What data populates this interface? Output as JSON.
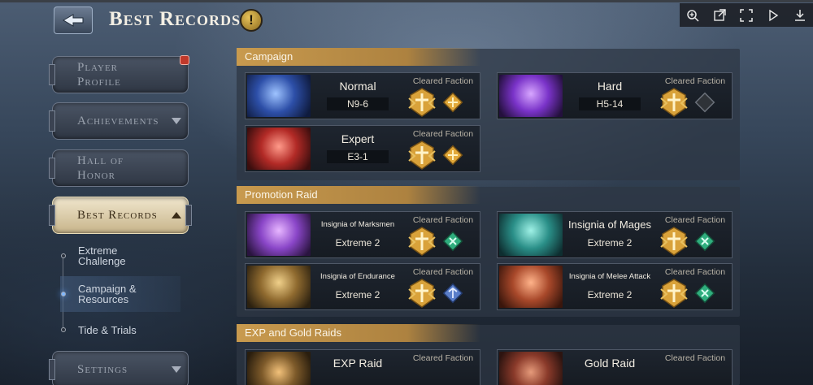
{
  "header": {
    "title": "Best Records",
    "info_symbol": "!"
  },
  "viewer_tools": [
    "zoom-in-icon",
    "open-external-icon",
    "fullscreen-icon",
    "play-icon",
    "download-icon"
  ],
  "sidebar": {
    "items": [
      {
        "label_line1": "Player",
        "label_line2": "Profile",
        "has_badge": true
      },
      {
        "label": "Achievements",
        "expandable": true
      },
      {
        "label_line1": "Hall of",
        "label_line2": "Honor"
      },
      {
        "label": "Best Records",
        "expandable": true,
        "active": true
      },
      {
        "label": "Settings",
        "expandable": true
      }
    ],
    "sub_items": [
      {
        "label": "Extreme Challenge"
      },
      {
        "label": "Campaign & Resources",
        "active": true
      },
      {
        "label": "Tide & Trials"
      }
    ]
  },
  "sections": {
    "campaign": {
      "title": "Campaign",
      "cards": [
        {
          "name": "Normal",
          "stage": "N9-6",
          "cleared_label": "Cleared",
          "faction_label": "Faction",
          "faction_style": "gold"
        },
        {
          "name": "Hard",
          "stage": "H5-14",
          "cleared_label": "Cleared",
          "faction_label": "Faction",
          "faction_style": "empty"
        },
        {
          "name": "Expert",
          "stage": "E3-1",
          "cleared_label": "Cleared",
          "faction_label": "Faction",
          "faction_style": "gold"
        }
      ]
    },
    "promotion_raid": {
      "title": "Promotion Raid",
      "cards": [
        {
          "name": "Insignia of Marksmen",
          "stage": "Extreme 2",
          "cleared_label": "Cleared",
          "faction_label": "Faction",
          "faction_style": "green"
        },
        {
          "name": "Insignia of Mages",
          "stage": "Extreme 2",
          "cleared_label": "Cleared",
          "faction_label": "Faction",
          "faction_style": "green"
        },
        {
          "name": "Insignia of Endurance",
          "stage": "Extreme 2",
          "cleared_label": "Cleared",
          "faction_label": "Faction",
          "faction_style": "blue"
        },
        {
          "name": "Insignia of Melee Attack",
          "stage": "Extreme 2",
          "cleared_label": "Cleared",
          "faction_label": "Faction",
          "faction_style": "green"
        }
      ]
    },
    "exp_gold_raids": {
      "title": "EXP and Gold Raids",
      "cards": [
        {
          "name": "EXP Raid",
          "cleared_label": "Cleared",
          "faction_label": "Faction"
        },
        {
          "name": "Gold Raid",
          "cleared_label": "Cleared",
          "faction_label": "Faction"
        }
      ]
    }
  },
  "colors": {
    "section_header": "#c89a4e",
    "active_button": "#f0e6cd",
    "faction_gold": "#e2a93a",
    "faction_green": "#2fae7e",
    "faction_blue": "#5a7ec9",
    "faction_empty": "#4a4f56"
  }
}
